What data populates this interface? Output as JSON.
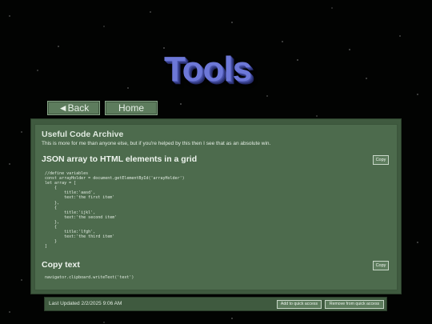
{
  "logo": {
    "text": "Tools"
  },
  "nav": {
    "back_label": "◄Back",
    "home_label": "Home"
  },
  "archive": {
    "title": "Useful Code Archive",
    "subtitle": "This is more for me than anyone else, but if you're helped by this then I see that as an absolute win."
  },
  "sections": [
    {
      "title": "JSON array to HTML elements in a grid",
      "copy_label": "Copy",
      "code": "//define variables\nconst arrayHolder = document.getElementById('arrayHolder')\nlet array = [\n    {\n        title:'aasd',\n        text:'the first item'\n    },\n    {\n        title:'ijkl',\n        text:'the second item'\n    },\n    {\n        title:'lfgh',\n        text:'the third item'\n    }\n]"
    },
    {
      "title": "Copy text",
      "copy_label": "Copy",
      "code": "navigator.clipboard.writeText('text')"
    }
  ],
  "footer": {
    "last_updated": "Last Updated 2/2/2025 9:06 AM",
    "add_label": "Add to quick access",
    "remove_label": "Remove from quick access"
  }
}
